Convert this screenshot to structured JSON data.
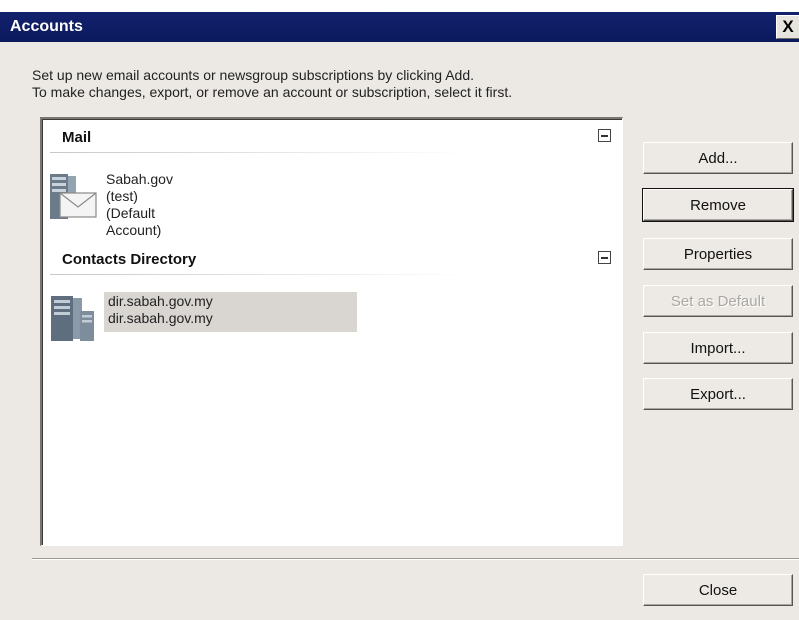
{
  "window": {
    "title": "Accounts",
    "close_glyph": "X"
  },
  "instructions": {
    "line1": "Set up new email accounts or newsgroup subscriptions by clicking Add.",
    "line2": "To make changes, export, or remove an account or subscription, select it first."
  },
  "groups": [
    {
      "label": "Mail",
      "toggle": "collapse",
      "items": [
        {
          "icon": "mail-server-icon",
          "line1": "Sabah.gov (test) (Default",
          "line2": "Account)"
        }
      ]
    },
    {
      "label": "Contacts Directory",
      "toggle": "collapse",
      "items": [
        {
          "icon": "directory-server-icon",
          "line1": "dir.sabah.gov.my",
          "line2": "dir.sabah.gov.my",
          "selected": true
        }
      ]
    }
  ],
  "buttons": {
    "add": "Add...",
    "remove": "Remove",
    "properties": "Properties",
    "set_default": "Set as Default",
    "import": "Import...",
    "export": "Export...",
    "close": "Close"
  },
  "colors": {
    "titlebar": "#0b1a5e",
    "dialog_bg": "#ece9e4",
    "selection_bg": "#d9d6d2"
  }
}
